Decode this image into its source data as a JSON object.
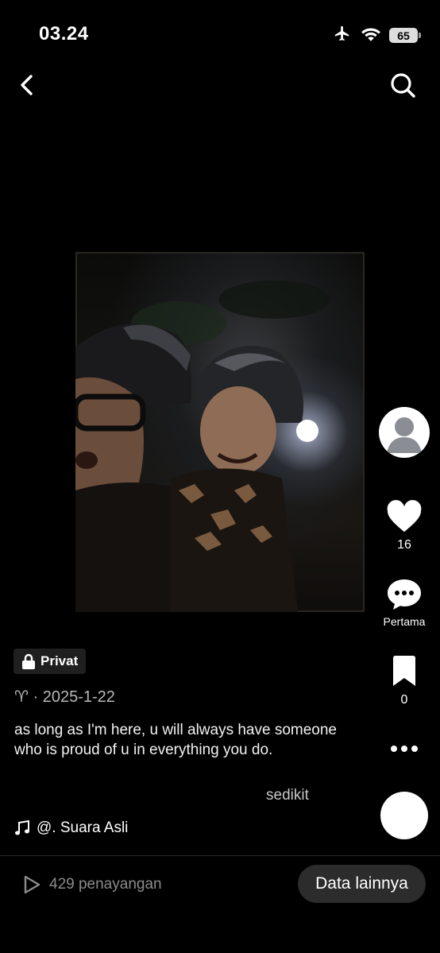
{
  "status_bar": {
    "time": "03.24",
    "battery": "65",
    "icons": [
      "airplane-icon",
      "wifi-icon",
      "battery-icon"
    ]
  },
  "nav": {
    "icons": [
      "back-chevron-icon",
      "search-icon"
    ]
  },
  "post": {
    "privacy_label": "Privat",
    "date_line": "♈ · 2025-1-22",
    "caption": "as long as I'm here, u will always have someone who is proud of u in everything you do.",
    "more_label": "sedikit",
    "sound": "@. Suara Asli"
  },
  "actions": {
    "like_count": "16",
    "comment_label": "Pertama",
    "bookmark_count": "0"
  },
  "footer": {
    "views": "429 penayangan",
    "more_data_button": "Data lainnya"
  },
  "colors": {
    "background": "#000000",
    "text": "#ffffff",
    "muted": "#8b8b8b",
    "pill": "#2c2c2c"
  }
}
